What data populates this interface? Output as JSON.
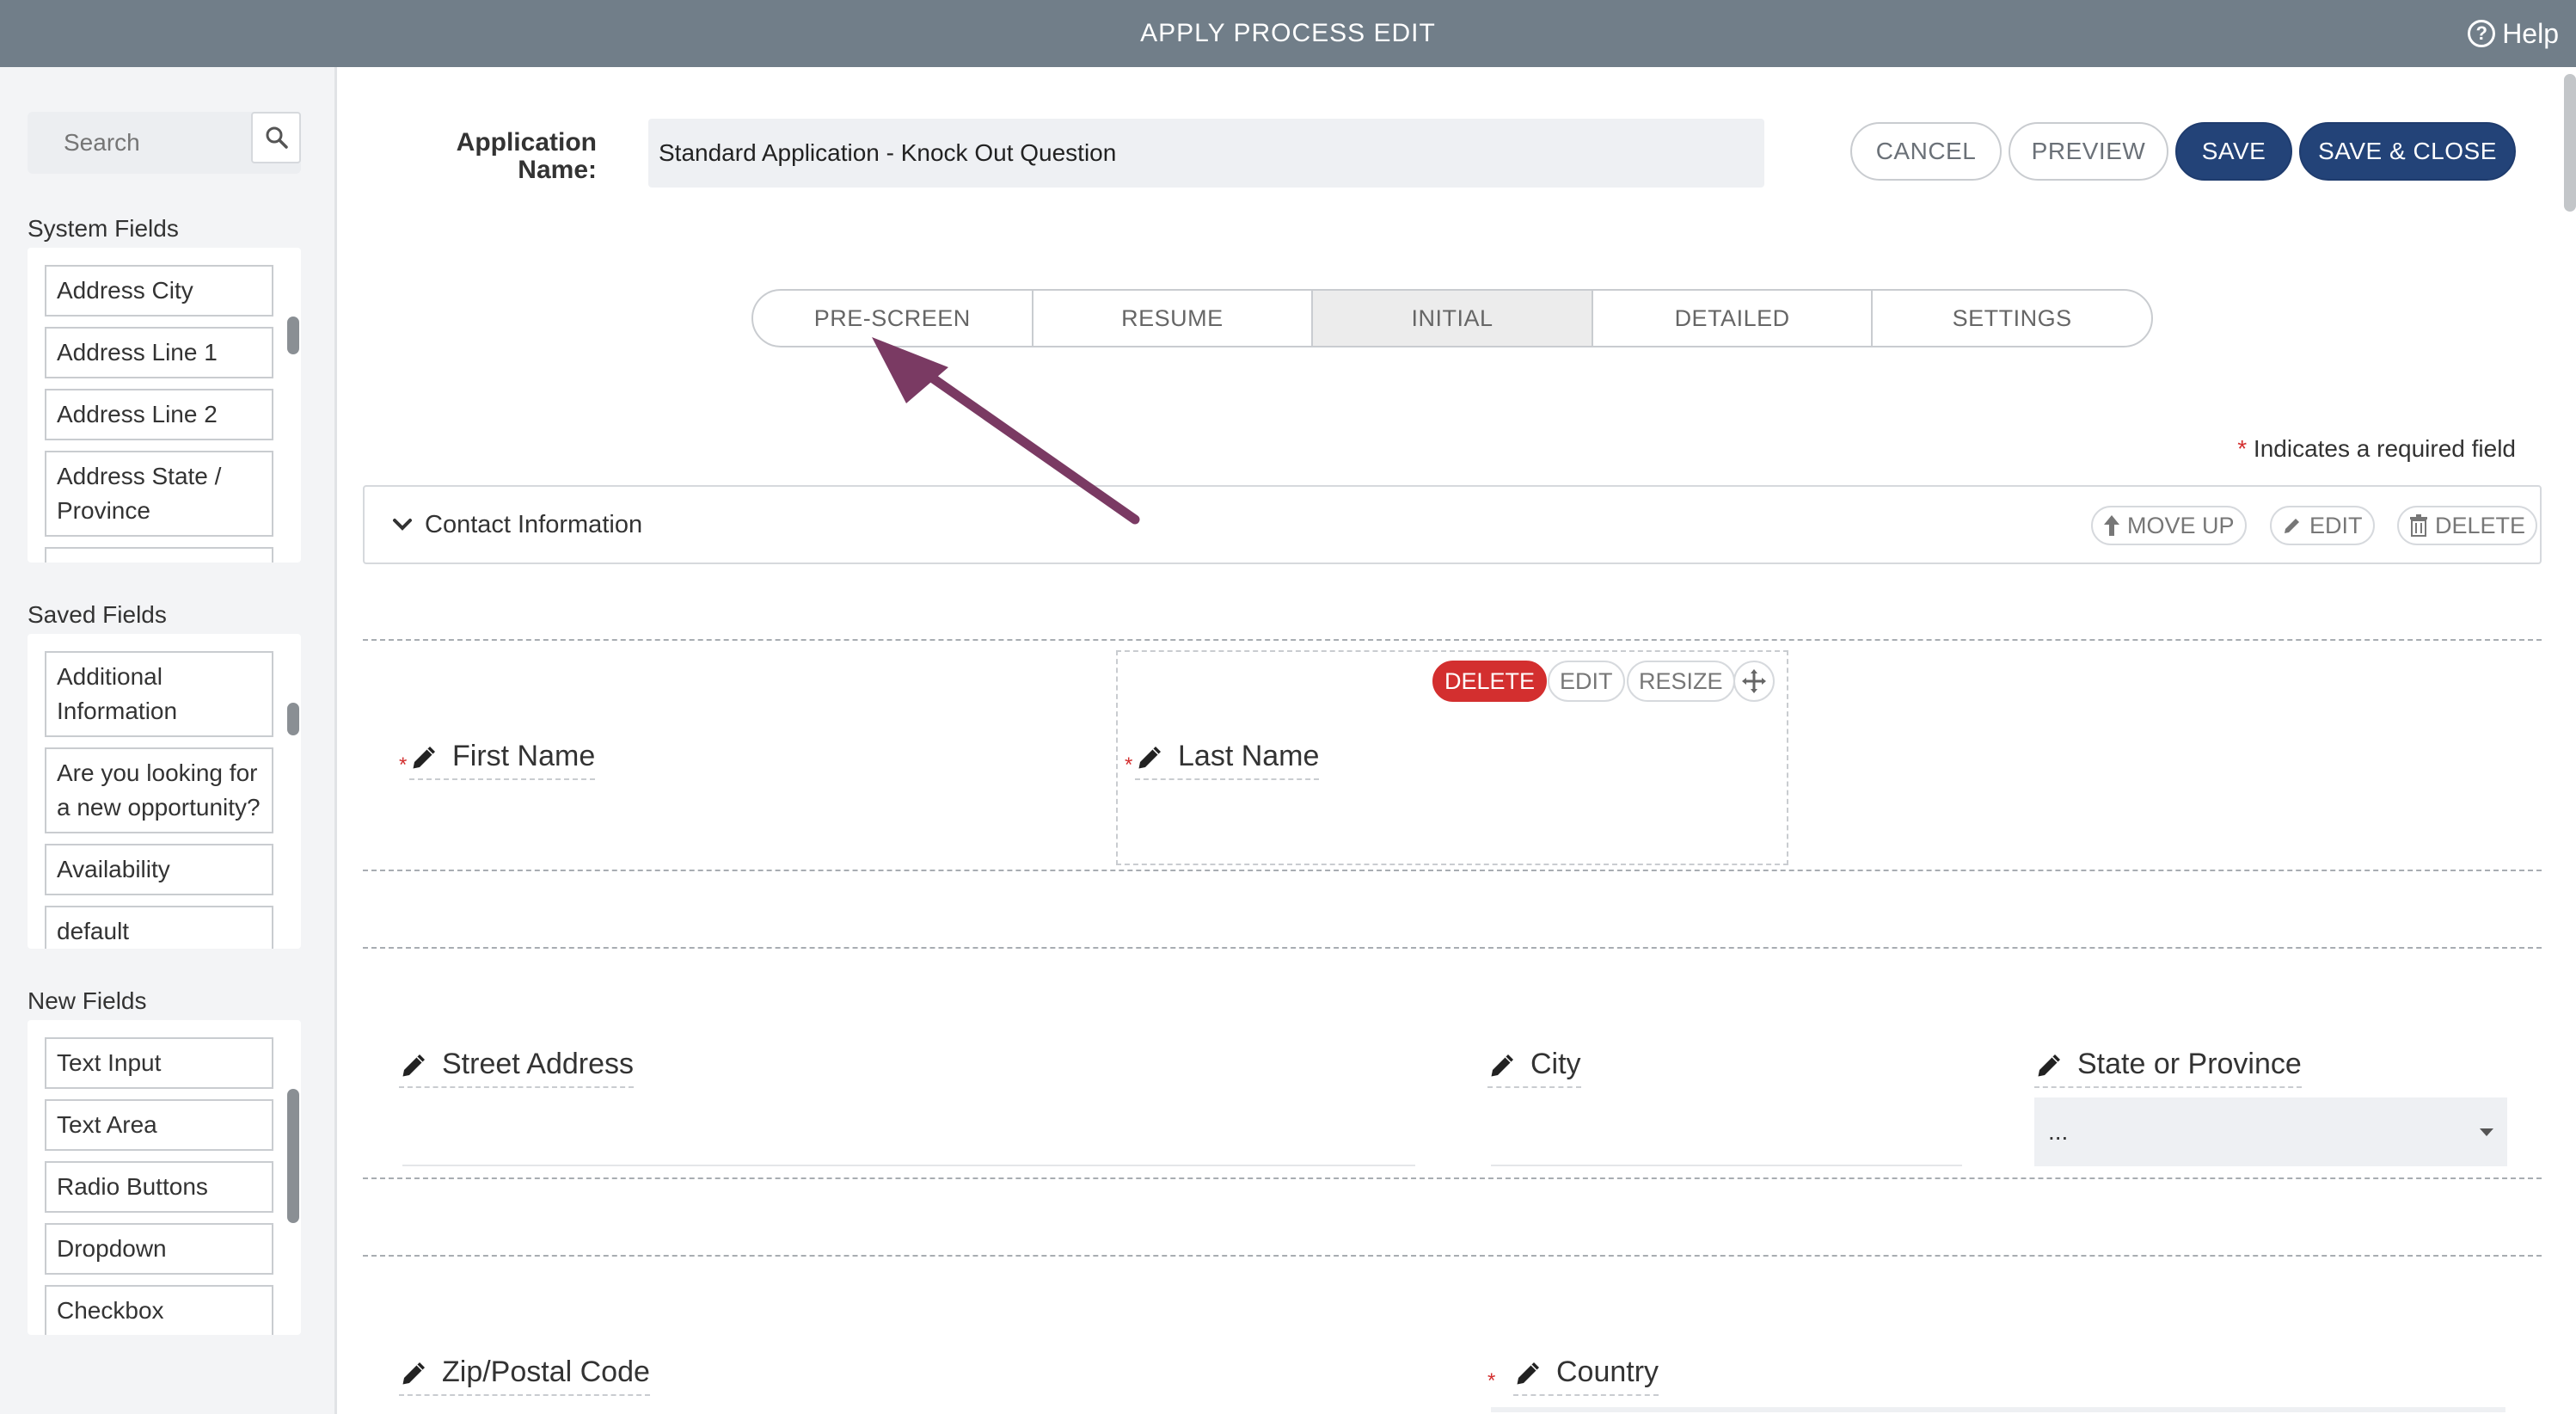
{
  "header": {
    "title": "APPLY PROCESS EDIT",
    "help_label": "Help"
  },
  "sidebar": {
    "search_placeholder": "Search",
    "system_fields_label": "System Fields",
    "system_fields": [
      "Address City",
      "Address Line 1",
      "Address Line 2",
      "Address State / Province"
    ],
    "saved_fields_label": "Saved Fields",
    "saved_fields": [
      "Additional Information",
      "Are you looking for a new opportunity?",
      "Availability",
      "default"
    ],
    "new_fields_label": "New Fields",
    "new_fields": [
      "Text Input",
      "Text Area",
      "Radio Buttons",
      "Dropdown",
      "Checkbox"
    ]
  },
  "form": {
    "app_name_label": "Application Name:",
    "app_name_value": "Standard Application - Knock Out Question"
  },
  "toolbar": {
    "cancel": "CANCEL",
    "preview": "PREVIEW",
    "save": "SAVE",
    "save_close": "SAVE & CLOSE"
  },
  "tabs": [
    {
      "label": "PRE-SCREEN",
      "active": false
    },
    {
      "label": "RESUME",
      "active": false
    },
    {
      "label": "INITIAL",
      "active": true
    },
    {
      "label": "DETAILED",
      "active": false
    },
    {
      "label": "SETTINGS",
      "active": false
    }
  ],
  "required_note": {
    "star": "*",
    "text": "Indicates a required field"
  },
  "section": {
    "title": "Contact Information",
    "move_up": "MOVE UP",
    "edit": "EDIT",
    "delete": "DELETE"
  },
  "field_actions": {
    "delete": "DELETE",
    "edit": "EDIT",
    "resize": "RESIZE"
  },
  "fields": {
    "first_name": "First Name",
    "last_name": "Last Name",
    "street": "Street Address",
    "city": "City",
    "state": "State or Province",
    "state_value": "...",
    "zip": "Zip/Postal Code",
    "country": "Country",
    "required_star": "*"
  },
  "colors": {
    "topbar": "#717e89",
    "primary": "#234378",
    "danger": "#d32f2f",
    "arrow": "#7a3a63"
  },
  "icons": [
    "help-circle-icon",
    "search-icon",
    "chevron-down-icon",
    "arrow-up-icon",
    "pencil-icon",
    "trash-icon",
    "move-icon",
    "caret-down-icon"
  ]
}
